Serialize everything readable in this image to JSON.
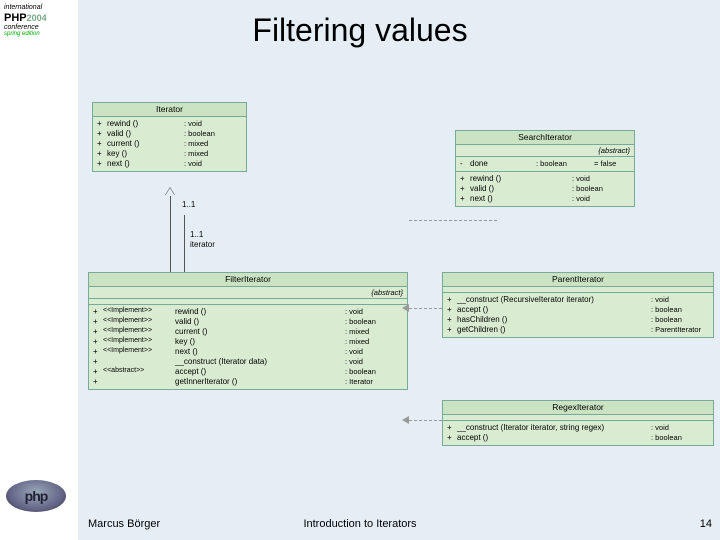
{
  "title": "Filtering values",
  "footer": {
    "author": "Marcus Börger",
    "title": "Introduction to Iterators",
    "page": "14"
  },
  "logo": {
    "top": {
      "l1": "international",
      "l2a": "PHP",
      "l2b": "2004",
      "l3": "conference",
      "l4": "spring edition"
    },
    "bot": "php"
  },
  "iterator": {
    "name": "Iterator",
    "methods": [
      {
        "vis": "+",
        "name": "rewind ()",
        "type": ": void"
      },
      {
        "vis": "+",
        "name": "valid ()",
        "type": ": boolean"
      },
      {
        "vis": "+",
        "name": "current ()",
        "type": ": mixed"
      },
      {
        "vis": "+",
        "name": "key ()",
        "type": ": mixed"
      },
      {
        "vis": "+",
        "name": "next ()",
        "type": ": void"
      }
    ]
  },
  "assoc": {
    "m1": "1..1",
    "m2": "1..1",
    "role": "iterator"
  },
  "search": {
    "name": "SearchIterator",
    "stereo": "{abstract}",
    "attrs": [
      {
        "vis": "-",
        "name": "done",
        "type": ": boolean",
        "def": "= false"
      }
    ],
    "methods": [
      {
        "vis": "+",
        "name": "rewind ()",
        "type": ": void"
      },
      {
        "vis": "+",
        "name": "valid ()",
        "type": ": boolean"
      },
      {
        "vis": "+",
        "name": "next ()",
        "type": ": void"
      }
    ]
  },
  "filter": {
    "name": "FilterIterator",
    "stereo": "{abstract}",
    "methods": [
      {
        "vis": "+",
        "st": "<<Implement>>",
        "name": "rewind ()",
        "type": ": void"
      },
      {
        "vis": "+",
        "st": "<<Implement>>",
        "name": "valid ()",
        "type": ": boolean"
      },
      {
        "vis": "+",
        "st": "<<Implement>>",
        "name": "current ()",
        "type": ": mixed"
      },
      {
        "vis": "+",
        "st": "<<Implement>>",
        "name": "key ()",
        "type": ": mixed"
      },
      {
        "vis": "+",
        "st": "<<Implement>>",
        "name": "next ()",
        "type": ": void"
      },
      {
        "vis": "+",
        "st": "",
        "name": "__construct (Iterator data)",
        "type": ": void"
      },
      {
        "vis": "+",
        "st": "<<abstract>>",
        "name": "accept ()",
        "type": ": boolean"
      },
      {
        "vis": "+",
        "st": "",
        "name": "getInnerIterator ()",
        "type": ": Iterator"
      }
    ]
  },
  "parent": {
    "name": "ParentIterator",
    "methods": [
      {
        "vis": "+",
        "name": "__construct (RecursiveIterator iterator)",
        "type": ": void"
      },
      {
        "vis": "+",
        "name": "accept ()",
        "type": ": boolean"
      },
      {
        "vis": "+",
        "name": "hasChildren ()",
        "type": ": boolean"
      },
      {
        "vis": "+",
        "name": "getChildren ()",
        "type": ": ParentIterator"
      }
    ]
  },
  "regex": {
    "name": "RegexIterator",
    "methods": [
      {
        "vis": "+",
        "name": "__construct (Iterator iterator, string regex)",
        "type": ": void"
      },
      {
        "vis": "+",
        "name": "accept ()",
        "type": ": boolean"
      }
    ]
  }
}
